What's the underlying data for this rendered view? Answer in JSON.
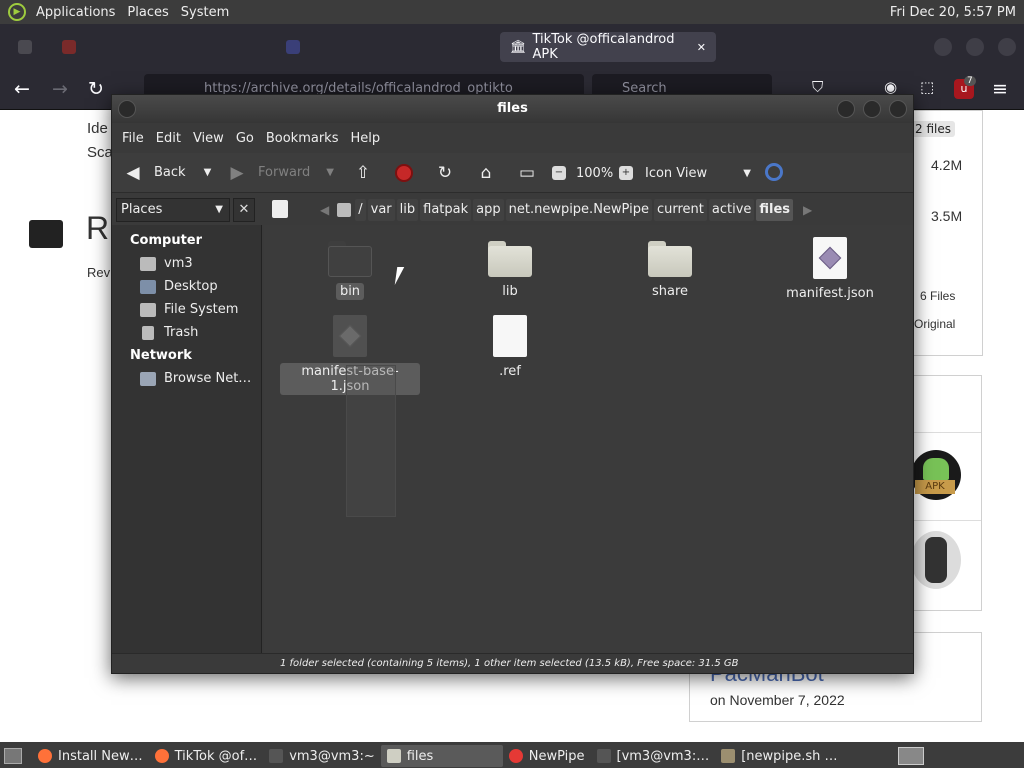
{
  "top_panel": {
    "menus": [
      "Applications",
      "Places",
      "System"
    ],
    "clock": "Fri Dec 20,  5:57 PM"
  },
  "browser": {
    "tabs": [
      {
        "label": "TikTok @officalandrod APK",
        "close": "✕"
      }
    ],
    "url": "https://archive.org/details/officalandrod_optikto",
    "search_placeholder": "Search",
    "extension_badge": "7",
    "page": {
      "left_text_1": "Ide",
      "left_text_2": "Sca",
      "left_text_3": "R",
      "left_text_4": "Rev",
      "files_count": "2 files",
      "size_1": "4.2M",
      "size_2": "3.5M",
      "six_files": "6 Files",
      "original": "Original",
      "apk_label": "APK",
      "author": "PacManBot",
      "date": "on November 7, 2022"
    }
  },
  "window": {
    "title": "files",
    "menu": [
      "File",
      "Edit",
      "View",
      "Go",
      "Bookmarks",
      "Help"
    ],
    "toolbar": {
      "back": "Back",
      "forward": "Forward",
      "zoom": "100%",
      "view_mode": "Icon View"
    },
    "places_select": "Places",
    "breadcrumbs": [
      "/",
      "var",
      "lib",
      "flatpak",
      "app",
      "net.newpipe.NewPipe",
      "current",
      "active",
      "files"
    ],
    "sidebar": {
      "computer_header": "Computer",
      "computer_items": [
        "vm3",
        "Desktop",
        "File System",
        "Trash"
      ],
      "network_header": "Network",
      "network_items": [
        "Browse Net…"
      ]
    },
    "files": [
      {
        "name": "bin",
        "kind": "folder",
        "selected": true
      },
      {
        "name": "lib",
        "kind": "folder",
        "selected": false
      },
      {
        "name": "share",
        "kind": "folder",
        "selected": false
      },
      {
        "name": "manifest.json",
        "kind": "json",
        "selected": false
      },
      {
        "name": "manifest-base-1.json",
        "kind": "json",
        "selected": true
      },
      {
        "name": ".ref",
        "kind": "file",
        "selected": false
      }
    ],
    "status": "1 folder selected (containing 5 items), 1 other item selected (13.5 kB), Free space: 31.5 GB"
  },
  "taskbar": {
    "tasks": [
      "Install New…",
      "TikTok @of…",
      "vm3@vm3:~",
      "files",
      "NewPipe",
      "[vm3@vm3:…",
      "[newpipe.sh …"
    ]
  },
  "colors": {
    "firefox_icon": "#ff7139",
    "newpipe_red": "#e53935",
    "selection": "#5c5c5c"
  }
}
